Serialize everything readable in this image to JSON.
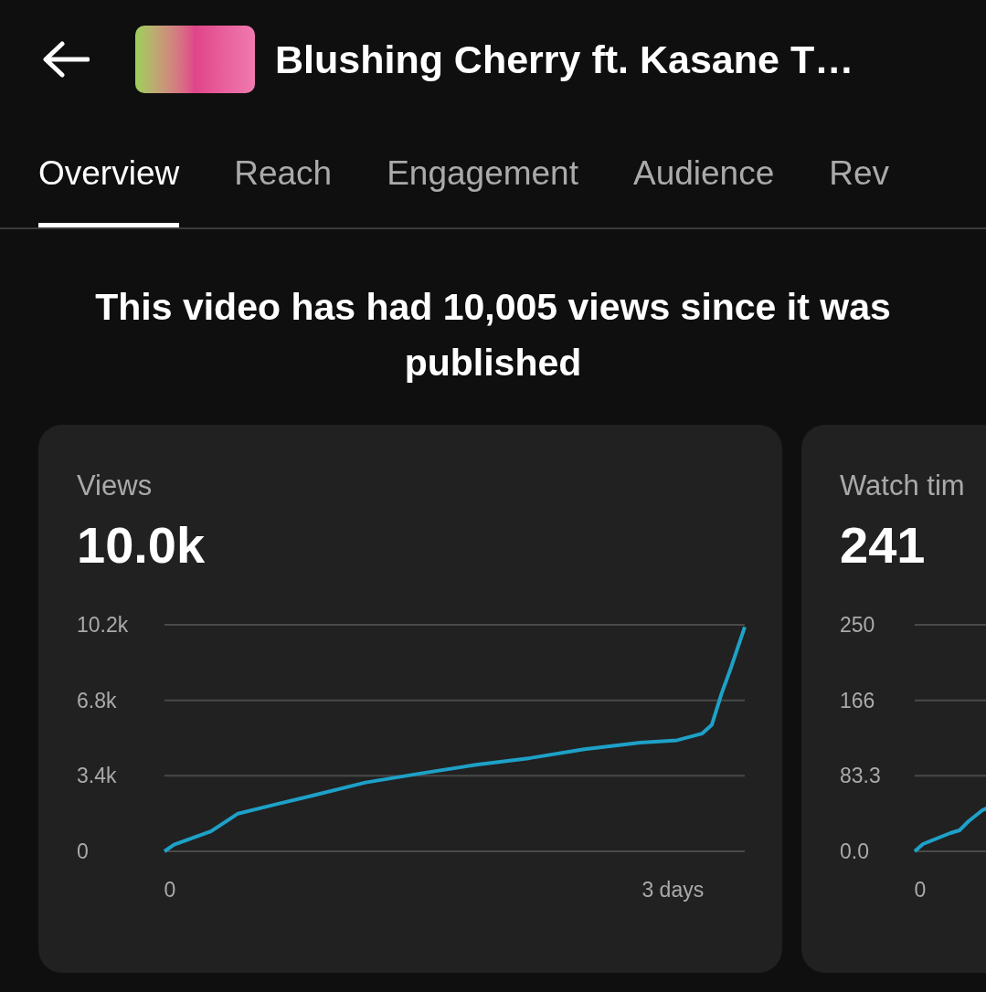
{
  "header": {
    "title": "Blushing Cherry ft. Kasane T…"
  },
  "tabs": [
    {
      "label": "Overview",
      "selected": true
    },
    {
      "label": "Reach",
      "selected": false
    },
    {
      "label": "Engagement",
      "selected": false
    },
    {
      "label": "Audience",
      "selected": false
    },
    {
      "label": "Rev",
      "selected": false
    }
  ],
  "headline": "This video has had 10,005 views since it was published",
  "cards": [
    {
      "label": "Views",
      "value": "10.0k",
      "chart_data": {
        "type": "line",
        "xlim": [
          0,
          3
        ],
        "ylim": [
          0,
          10200
        ],
        "xticks": [
          {
            "value": 0,
            "label": "0"
          },
          {
            "value": 2.6,
            "label": "3 days"
          }
        ],
        "yticks": [
          {
            "value": 0,
            "label": "0"
          },
          {
            "value": 3400,
            "label": "3.4k"
          },
          {
            "value": 6800,
            "label": "6.8k"
          },
          {
            "value": 10200,
            "label": "10.2k"
          }
        ],
        "series": [
          {
            "color": "#1ea1c8",
            "values": [
              0,
              300,
              900,
              1700,
              2100,
              2500,
              3100,
              3500,
              3900,
              4200,
              4600,
              4900,
              5000,
              5300,
              5700,
              7100,
              8300,
              10100
            ]
          }
        ],
        "x": [
          0,
          0.05,
          0.24,
          0.38,
          0.57,
          0.76,
          1.04,
          1.32,
          1.61,
          1.89,
          2.17,
          2.46,
          2.65,
          2.78,
          2.83,
          2.88,
          2.93,
          3
        ]
      }
    },
    {
      "label": "Watch tim",
      "value": "241",
      "y_axis_labels": [
        "250",
        "166",
        "83.3",
        "0.0"
      ],
      "x_axis_labels": [
        "0"
      ]
    }
  ]
}
